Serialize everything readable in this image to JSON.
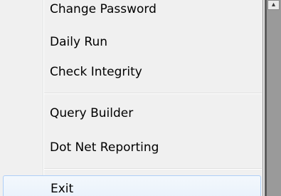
{
  "menu": {
    "items": [
      {
        "label": "Change Password"
      },
      {
        "label": "Daily Run"
      },
      {
        "label": "Check Integrity"
      },
      {
        "label": "Query Builder"
      },
      {
        "label": "Dot Net Reporting"
      },
      {
        "label": "Exit"
      }
    ],
    "highlighted_item": "Exit"
  },
  "colors": {
    "menu_background": "#f0f0f0",
    "highlight_border": "#aecff7",
    "highlight_fill": "#e8f1fb",
    "background_window": "#9a9a9a"
  },
  "icons": {
    "scroll_button": "scroll-arrow-icon"
  }
}
